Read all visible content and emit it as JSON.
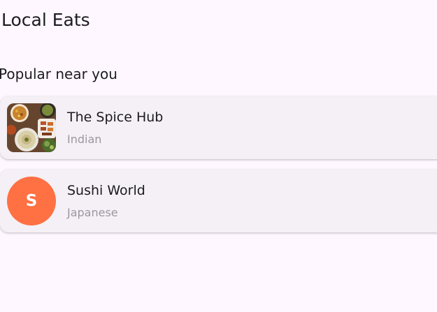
{
  "app": {
    "title": "Local Eats"
  },
  "section": {
    "title": "Popular near you"
  },
  "restaurants": [
    {
      "name": "The Spice Hub",
      "cuisine": "Indian",
      "image": "food-photo"
    },
    {
      "name": "Sushi World",
      "cuisine": "Japanese",
      "avatar_letter": "S",
      "avatar_color": "#FF7043"
    }
  ],
  "colors": {
    "background": "#FEF7FF",
    "card": "#F4F0F5",
    "text_primary": "#1D1B20",
    "text_secondary": "#9B979F"
  }
}
